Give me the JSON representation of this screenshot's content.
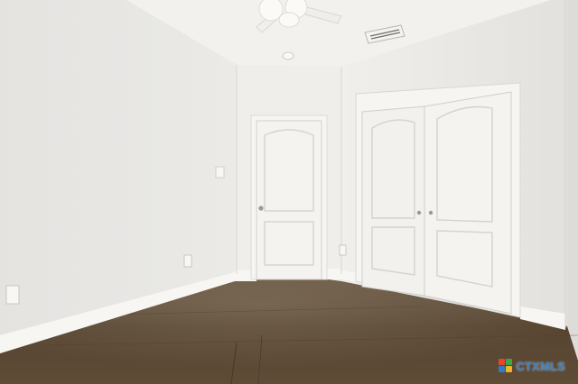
{
  "scene": {
    "kind": "photo",
    "colors": {
      "wall_left": "#e9e8e5",
      "wall_back": "#eeedea",
      "wall_right": "#e6e5e2",
      "ceiling": "#f3f2ef",
      "floor": "#5a4a36",
      "door": "#f4f3f0",
      "trim": "#f7f6f3"
    }
  },
  "watermark": {
    "text": "CTXMLS",
    "colors": [
      "#e8462b",
      "#3fa54a",
      "#2f7dc3",
      "#f0b429"
    ]
  }
}
